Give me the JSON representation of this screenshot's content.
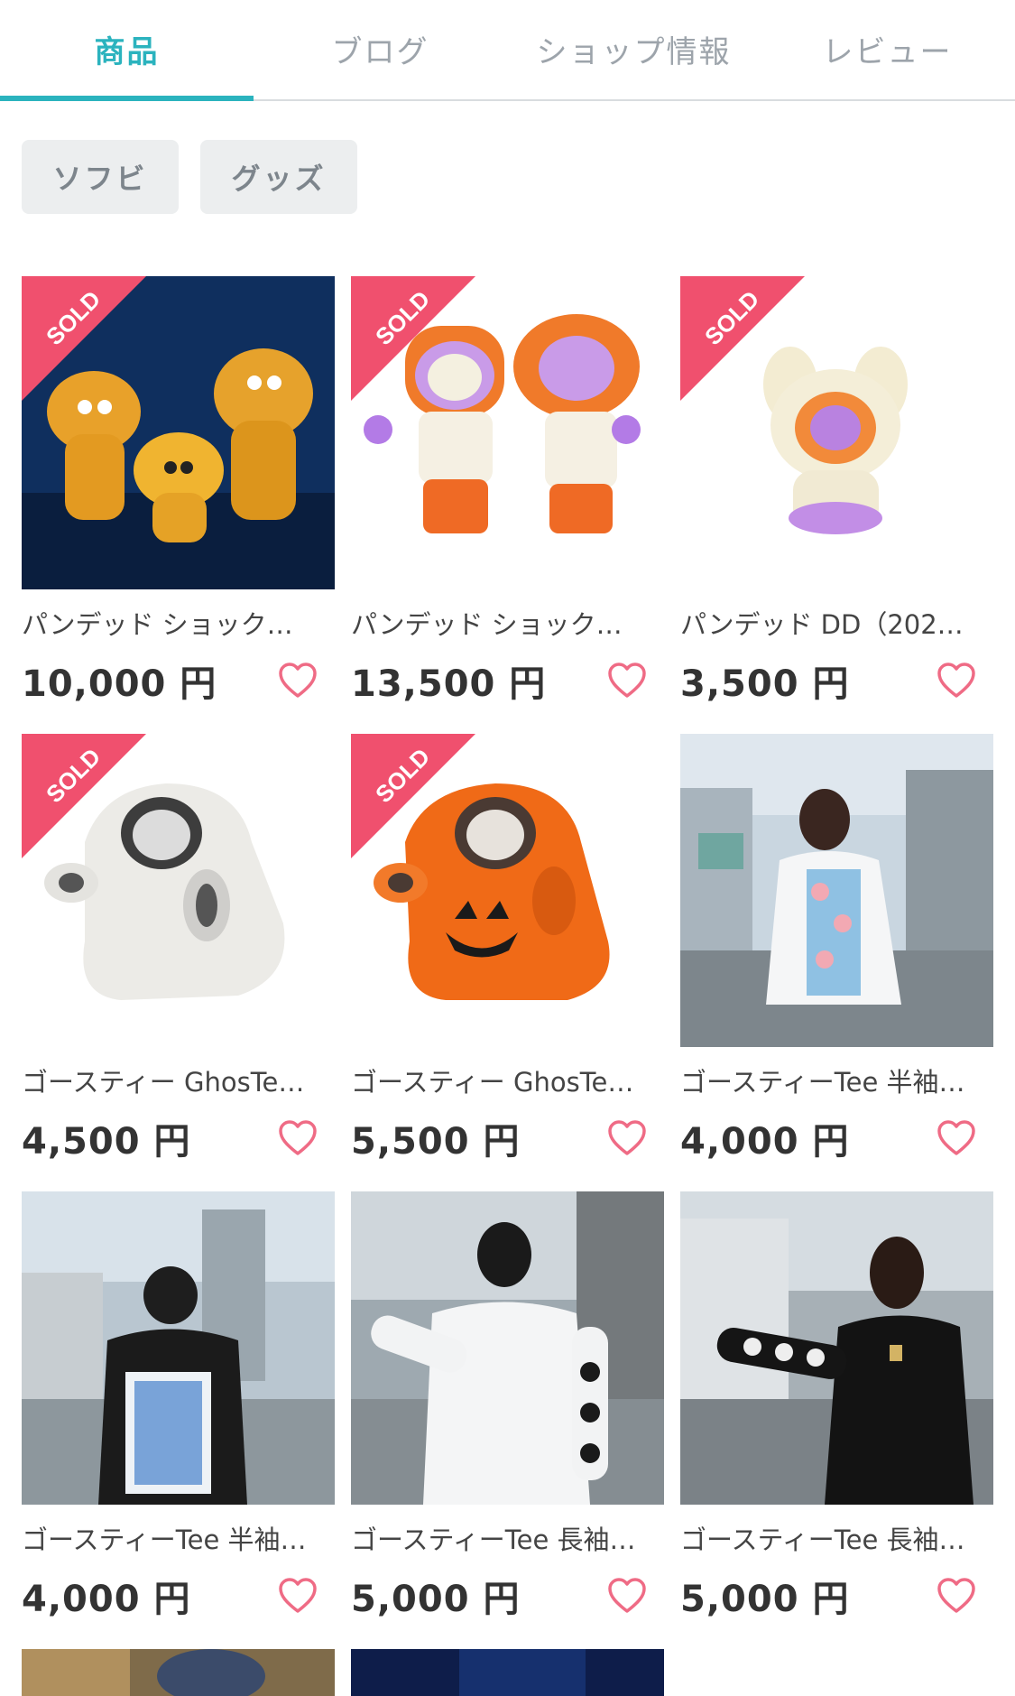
{
  "tabs": [
    {
      "label": "商品"
    },
    {
      "label": "ブログ"
    },
    {
      "label": "ショップ情報"
    },
    {
      "label": "レビュー"
    }
  ],
  "filters": [
    {
      "label": "ソフビ"
    },
    {
      "label": "グッズ"
    }
  ],
  "sold_badge": "SOLD",
  "products": [
    {
      "name": "パンデッド ショック…",
      "price": "10,000 円",
      "sold": true
    },
    {
      "name": "パンデッド ショック…",
      "price": "13,500 円",
      "sold": true
    },
    {
      "name": "パンデッド DD（202…",
      "price": "3,500 円",
      "sold": true
    },
    {
      "name": "ゴースティー GhosTe…",
      "price": "4,500 円",
      "sold": true
    },
    {
      "name": "ゴースティー GhosTe…",
      "price": "5,500 円",
      "sold": true
    },
    {
      "name": "ゴースティーTee 半袖…",
      "price": "4,000 円",
      "sold": false
    },
    {
      "name": "ゴースティーTee 半袖…",
      "price": "4,000 円",
      "sold": false
    },
    {
      "name": "ゴースティーTee 長袖…",
      "price": "5,000 円",
      "sold": false
    },
    {
      "name": "ゴースティーTee 長袖…",
      "price": "5,000 円",
      "sold": false
    }
  ],
  "colors": {
    "accent": "#2bb3be",
    "sold": "#f0506e",
    "heart": "#ef6b85"
  }
}
